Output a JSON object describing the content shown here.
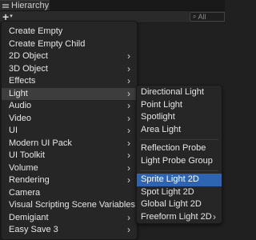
{
  "panel": {
    "title": "Hierarchy"
  },
  "toolbar": {
    "add_symbol": "+",
    "caret": "▾",
    "search_placeholder": "All"
  },
  "main_menu": {
    "items": [
      {
        "label": "Create Empty",
        "arrow": ""
      },
      {
        "label": "Create Empty Child",
        "arrow": ""
      },
      {
        "label": "2D Object",
        "arrow": "›"
      },
      {
        "label": "3D Object",
        "arrow": "›"
      },
      {
        "label": "Effects",
        "arrow": "›"
      },
      {
        "label": "Light",
        "arrow": "›"
      },
      {
        "label": "Audio",
        "arrow": "›"
      },
      {
        "label": "Video",
        "arrow": "›"
      },
      {
        "label": "UI",
        "arrow": "›"
      },
      {
        "label": "Modern UI Pack",
        "arrow": "›"
      },
      {
        "label": "UI Toolkit",
        "arrow": "›"
      },
      {
        "label": "Volume",
        "arrow": "›"
      },
      {
        "label": "Rendering",
        "arrow": "›"
      },
      {
        "label": "Camera",
        "arrow": ""
      },
      {
        "label": "Visual Scripting Scene Variables",
        "arrow": ""
      },
      {
        "label": "Demigiant",
        "arrow": "›"
      },
      {
        "label": "Easy Save 3",
        "arrow": "›"
      }
    ],
    "highlighted": "Light"
  },
  "light_menu": {
    "group1": [
      {
        "label": "Directional Light"
      },
      {
        "label": "Point Light"
      },
      {
        "label": "Spotlight"
      },
      {
        "label": "Area Light"
      }
    ],
    "group2": [
      {
        "label": "Reflection Probe"
      },
      {
        "label": "Light Probe Group"
      }
    ],
    "group3": [
      {
        "label": "Sprite Light 2D",
        "arrow": ""
      },
      {
        "label": "Spot Light 2D",
        "arrow": ""
      },
      {
        "label": "Global Light 2D",
        "arrow": ""
      },
      {
        "label": "Freeform Light 2D",
        "arrow": "›"
      }
    ],
    "selected": "Sprite Light 2D"
  },
  "colors": {
    "background": "#202020",
    "menu_bg": "#262626",
    "hover": "#3d3d3d",
    "selection": "#2f64b2",
    "text": "#e6e6e6"
  },
  "icons": [
    "hierarchy-list-icon",
    "add-icon",
    "dropdown-caret-icon",
    "search-icon",
    "submenu-arrow-icon"
  ]
}
